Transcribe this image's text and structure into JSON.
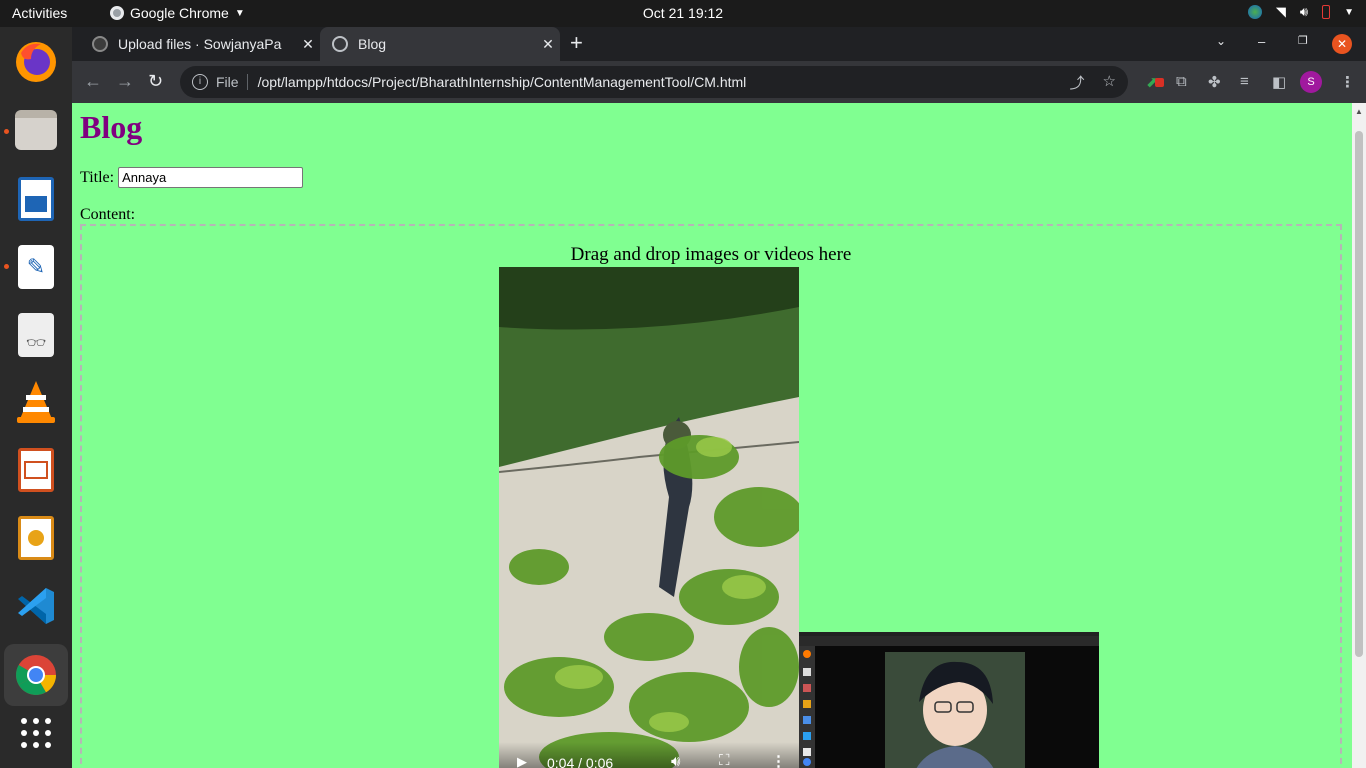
{
  "topbar": {
    "activities": "Activities",
    "app_name": "Google Chrome",
    "clock": "Oct 21  19:12"
  },
  "dock": {
    "items": [
      "firefox-icon",
      "files-icon",
      "writer-icon",
      "text-editor-icon",
      "document-viewer-icon",
      "vlc-icon",
      "impress-icon",
      "draw-icon",
      "vscode-icon",
      "chrome-icon",
      "show-apps-icon"
    ]
  },
  "tabs": [
    {
      "title": "Upload files · SowjanyaPa",
      "active": false
    },
    {
      "title": "Blog",
      "active": true
    }
  ],
  "toolbar": {
    "file_label": "File",
    "url": "/opt/lampp/htdocs/Project/BharathInternship/ContentManagementTool/CM.html",
    "profile_initial": "S"
  },
  "page": {
    "heading": "Blog",
    "title_label": "Title:",
    "title_value": "Annaya",
    "content_label": "Content:",
    "dropzone_hint": "Drag and drop images or videos here",
    "video_time": "0:04 / 0:06"
  },
  "colors": {
    "page_bg": "#80ff91",
    "heading": "#800080",
    "accent_close": "#e95420"
  }
}
